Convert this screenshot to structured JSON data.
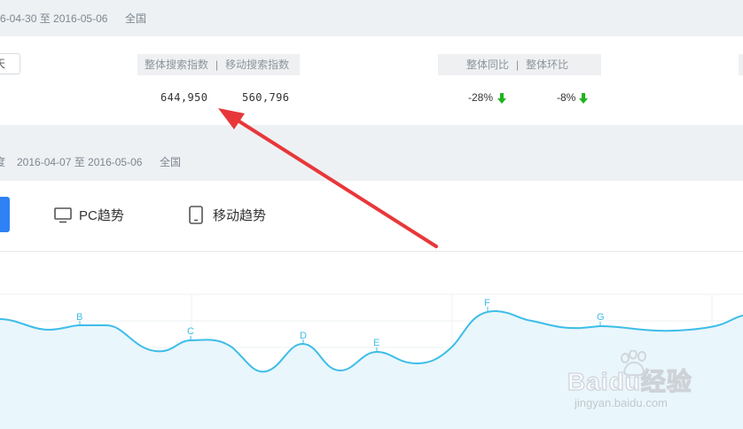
{
  "top_band": {
    "date_range": "6-04-30 至 2016-05-06",
    "region": "全国"
  },
  "period_select": {
    "value": "天"
  },
  "search_index": {
    "header_overall": "整体搜索指数",
    "header_sep": "|",
    "header_mobile": "移动搜索指数",
    "overall_value": "644,950",
    "mobile_value": "560,796"
  },
  "change": {
    "header_yoy": "整体同比",
    "header_sep": "|",
    "header_mom": "整体环比",
    "yoy_value": "-28%",
    "mom_value": "-8%"
  },
  "trend_band": {
    "prefix": "度",
    "date_range": "2016-04-07 至 2016-05-06",
    "region": "全国"
  },
  "tabs": {
    "pc_label": "PC趋势",
    "mobile_label": "移动趋势"
  },
  "chart_data": {
    "type": "area",
    "annotations": [
      "B",
      "C",
      "D",
      "E",
      "F",
      "G"
    ]
  },
  "watermark": {
    "brand": "Baidu经验",
    "url": "jingyan.baidu.com"
  },
  "colors": {
    "accent_blue": "#2e82f5",
    "line": "#3dbde8",
    "arrow_red": "#e8373a",
    "down_green": "#1fb31f"
  }
}
